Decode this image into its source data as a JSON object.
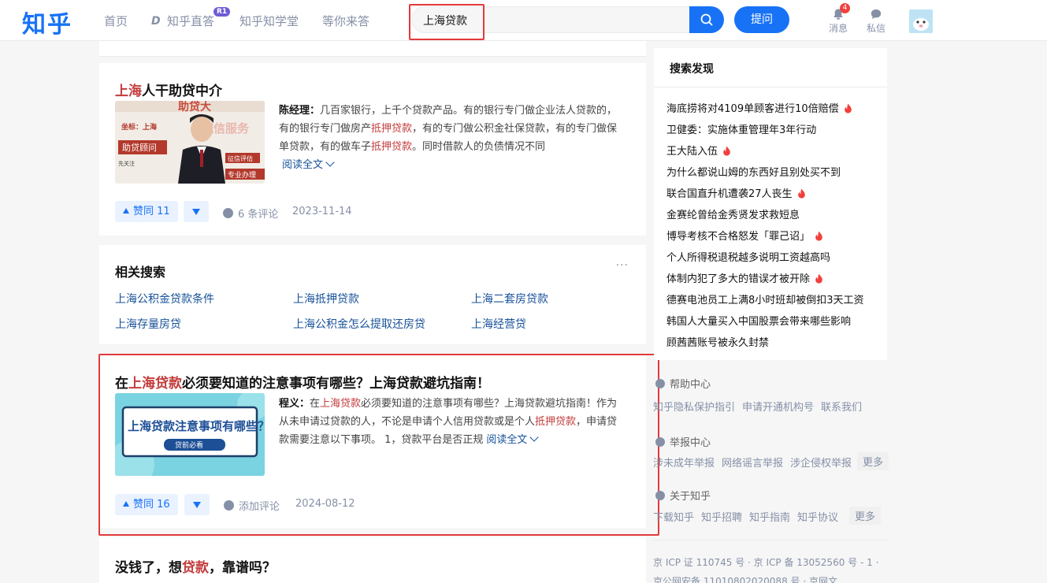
{
  "header": {
    "logo": "知乎",
    "nav": [
      "首页",
      "知乎直答",
      "知乎知学堂",
      "等你来答"
    ],
    "zhida_badge": "R1",
    "search_value": "上海贷款",
    "ask_label": "提问",
    "messages_label": "消息",
    "messages_count": "4",
    "pm_label": "私信"
  },
  "card1": {
    "title_hl": "上海",
    "title_rest": "人干助贷中介",
    "author": "陈经理：",
    "excerpt_1": "几百家银行，上千个贷款产品。有的银行专门做企业法人贷款的，有的银行专门做房产",
    "excerpt_hl1": "抵押贷款",
    "excerpt_2": "，有的专门做公积金社保贷款，有的专门做保单贷款，有的做车子",
    "excerpt_hl2": "抵押贷款",
    "excerpt_3": "。同时借款人的负债情况不同",
    "read_more": "阅读全文",
    "vote": "赞同 11",
    "comments": "6 条评论",
    "date": "2023-11-14",
    "thumb": {
      "top": "助贷大",
      "tag": "坐标：上海",
      "slogan": "诚信服务",
      "role": "助贷顾问",
      "eval": "征信评估",
      "pro": "专业办理",
      "follow": "先关注"
    }
  },
  "related": {
    "title": "相关搜索",
    "more": "···",
    "links": [
      "上海公积金贷款条件",
      "上海抵押贷款",
      "上海二套房贷款",
      "上海存量房贷",
      "上海公积金怎么提取还房贷",
      "上海经营贷"
    ]
  },
  "card3": {
    "title_1": "在",
    "title_hl": "上海贷款",
    "title_2": "必须要知道的注意事项有哪些？上海贷款避坑指南！",
    "author": "程义：",
    "excerpt_1": "在",
    "excerpt_hl1": "上海贷款",
    "excerpt_2": "必须要知道的注意事项有哪些？上海贷款避坑指南！作为从未申请过贷款的人，不论是申请个人信用贷款或是个人",
    "excerpt_hl2": "抵押贷款",
    "excerpt_3": "，申请贷款需要注意以下事项。 1，贷款平台是否正规",
    "read_more": "阅读全文",
    "vote": "赞同 16",
    "comments": "添加评论",
    "date": "2024-08-12",
    "thumb_title": "上海贷款注意事项有哪些？",
    "thumb_btn": "贷前必看"
  },
  "card4": {
    "title_1": "没钱了，想",
    "title_hl": "贷款",
    "title_2": "，靠谱吗？"
  },
  "sidebar": {
    "title": "搜索发现",
    "items": [
      {
        "text": "海底捞将对4109单顾客进行10倍赔偿",
        "hot": true
      },
      {
        "text": "卫健委：实施体重管理年3年行动",
        "hot": false
      },
      {
        "text": "王大陆入伍",
        "hot": true
      },
      {
        "text": "为什么都说山姆的东西好且别处买不到",
        "hot": false
      },
      {
        "text": "联合国直升机遭袭27人丧生",
        "hot": true
      },
      {
        "text": "金赛纶曾给金秀贤发求救短息",
        "hot": false
      },
      {
        "text": "博导考核不合格怒发「罪己诏」",
        "hot": true
      },
      {
        "text": "个人所得税退税越多说明工资越高吗",
        "hot": false
      },
      {
        "text": "体制内犯了多大的错误才被开除",
        "hot": true
      },
      {
        "text": "德赛电池员工上满8小时班却被倒扣3天工资",
        "hot": false
      },
      {
        "text": "韩国人大量买入中国股票会带来哪些影响",
        "hot": false
      },
      {
        "text": "顾茜茜账号被永久封禁",
        "hot": false
      }
    ]
  },
  "footer": {
    "help_title": "帮助中心",
    "help_links": [
      "知乎隐私保护指引",
      "申请开通机构号",
      "联系我们"
    ],
    "report_title": "举报中心",
    "report_links": [
      "涉未成年举报",
      "网络谣言举报",
      "涉企侵权举报"
    ],
    "about_title": "关于知乎",
    "about_links": [
      "下载知乎",
      "知乎招聘",
      "知乎指南",
      "知乎协议"
    ],
    "more": "更多",
    "icp_1": "京 ICP 证 110745 号 · 京 ICP 备 13052560 号 - 1 ·",
    "icp_2": "京公网安备 11010802020088 号 · 京网文"
  },
  "colors": {
    "brand": "#1772f6",
    "highlight_red": "#c33b3b",
    "annotation_red": "#e33a3a"
  }
}
